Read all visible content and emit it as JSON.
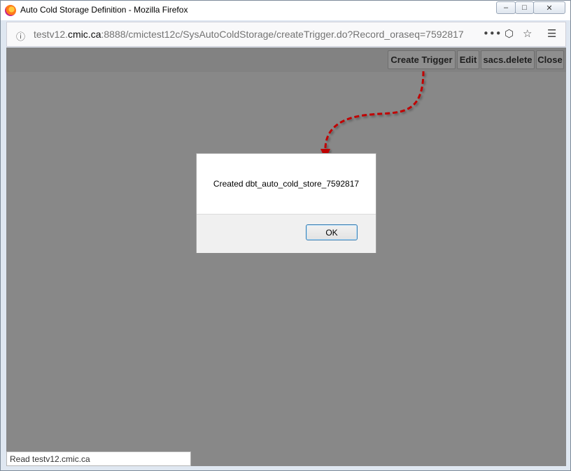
{
  "window": {
    "title": "Auto Cold Storage Definition - Mozilla Firefox"
  },
  "navbar": {
    "url_prefix": "testv12.",
    "url_host": "cmic.ca",
    "url_rest": ":8888/cmictest12c/SysAutoColdStorage/createTrigger.do?Record_oraseq=7592817"
  },
  "toolbar": {
    "create_trigger_label": "Create Trigger",
    "edit_label": "Edit",
    "delete_label": "sacs.delete",
    "close_label": "Close"
  },
  "dialog": {
    "message": "Created dbt_auto_cold_store_7592817",
    "ok_label": "OK"
  },
  "status": {
    "text": "Read testv12.cmic.ca"
  },
  "icons": {
    "browser": "firefox-logo-icon",
    "info": "info-icon",
    "more": "more-actions-icon",
    "pocket": "pocket-icon",
    "bookmark": "star-icon",
    "menu": "hamburger-menu-icon"
  },
  "colors": {
    "overlay": "#888888",
    "annotation_arrow": "#c00000",
    "ok_focus_border": "#3c7fb1"
  }
}
